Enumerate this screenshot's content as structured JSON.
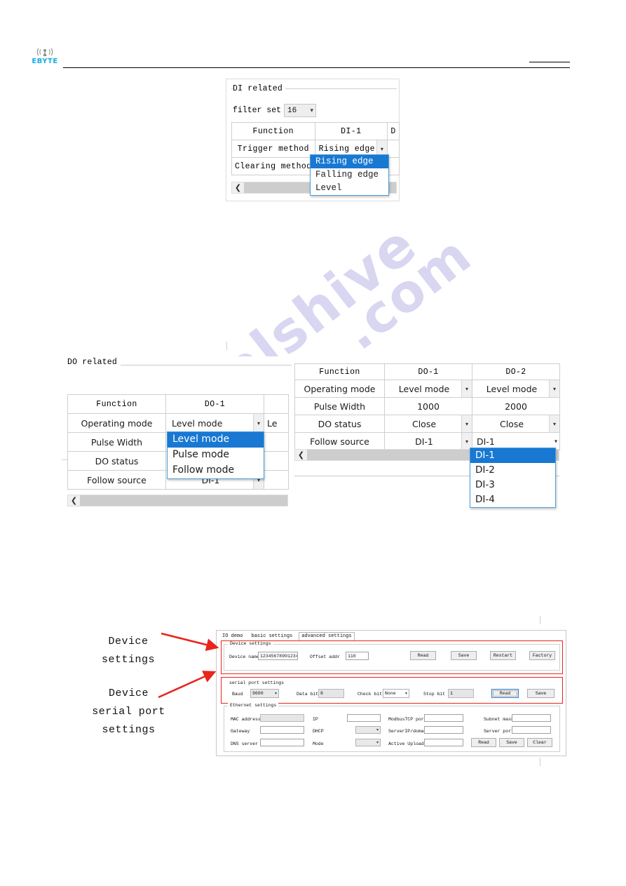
{
  "header": {
    "brand": "EBYTE",
    "logo_icon": "signal-tower-icon"
  },
  "watermark": {
    "line1": "manualshive",
    "line2": ".com"
  },
  "di_panel": {
    "group_title": "DI related",
    "filter_label": "filter set",
    "filter_value": "16",
    "table": {
      "headers": [
        "Function",
        "DI-1",
        "D"
      ],
      "rows": [
        {
          "label": "Trigger method",
          "value": "Rising edge"
        },
        {
          "label": "Clearing method",
          "value": ""
        }
      ]
    },
    "dropdown": {
      "selected": "Rising edge",
      "options": [
        "Rising edge",
        "Falling edge",
        "Level"
      ]
    },
    "scroll_left_icon": "chevron-left-icon"
  },
  "do_left_panel": {
    "group_title": "DO related",
    "table": {
      "headers": [
        "Function",
        "DO-1",
        "Le"
      ],
      "rows": [
        {
          "label": "Operating mode",
          "value": "Level mode",
          "next": "Le"
        },
        {
          "label": "Pulse Width",
          "value": ""
        },
        {
          "label": "DO status",
          "value": ""
        },
        {
          "label": "Follow source",
          "value": "DI-1"
        }
      ]
    },
    "dropdown": {
      "selected": "Level mode",
      "options": [
        "Level mode",
        "Pulse mode",
        "Follow mode"
      ]
    },
    "scroll_left_icon": "chevron-left-icon"
  },
  "do_right_panel": {
    "table": {
      "headers": [
        "Function",
        "DO-1",
        "DO-2"
      ],
      "rows": [
        {
          "label": "Operating mode",
          "do1": "Level mode",
          "do2": "Level mode"
        },
        {
          "label": "Pulse Width",
          "do1": "1000",
          "do2": "2000"
        },
        {
          "label": "DO status",
          "do1": "Close",
          "do2": "Close"
        },
        {
          "label": "Follow source",
          "do1": "DI-1",
          "do2": "DI-1"
        }
      ]
    },
    "dropdown": {
      "selected": "DI-1",
      "options": [
        "DI-1",
        "DI-2",
        "DI-3",
        "DI-4"
      ]
    },
    "scroll_left_icon": "chevron-left-icon"
  },
  "software": {
    "tabs": [
      {
        "label": "IO demo",
        "active": false
      },
      {
        "label": "basic settings",
        "active": false
      },
      {
        "label": "advanced settings",
        "active": true
      }
    ],
    "device_settings": {
      "legend": "Device settings",
      "device_name_label": "Device name",
      "device_name_value": "12345678901234",
      "offset_addr_label": "Offset addr",
      "offset_addr_value": "110",
      "buttons": [
        "Read",
        "Save",
        "Restart",
        "Factory"
      ]
    },
    "serial_port_settings": {
      "legend": "serial port settings",
      "baud_label": "Baud",
      "baud_value": "9600",
      "data_bit_label": "Data bit",
      "data_bit_value": "8",
      "check_bit_label": "Check bit",
      "check_bit_value": "None",
      "stop_bit_label": "Stop bit",
      "stop_bit_value": "1",
      "buttons": [
        "Read",
        "Save"
      ]
    },
    "ethernet_settings": {
      "legend": "Ethernet settings",
      "mac_label": "MAC address",
      "mac_value": "",
      "ip_label": "IP",
      "ip_value": "",
      "modbustcp_label": "ModbusTCP port",
      "modbustcp_value": "",
      "subnet_label": "Subnet mask",
      "subnet_value": "",
      "gateway_label": "Gateway",
      "gateway_value": "",
      "dhcp_label": "DHCP",
      "dhcp_value": "",
      "serverip_label": "ServerIP/domain",
      "serverip_value": "",
      "serverport_label": "Server port",
      "serverport_value": "",
      "dns_label": "DNS server",
      "dns_value": "",
      "mode_label": "Mode",
      "mode_value": "",
      "active_upload_label": "Active Upload",
      "active_upload_value": "",
      "buttons": [
        "Read",
        "Save",
        "Clear"
      ]
    }
  },
  "annotations": {
    "device_settings": "Device\nsettings",
    "device_settings_l1": "Device",
    "device_settings_l2": "settings",
    "serial_l1": "Device",
    "serial_l2": "serial port",
    "serial_l3": "settings",
    "arrow_color": "#e8261c"
  }
}
